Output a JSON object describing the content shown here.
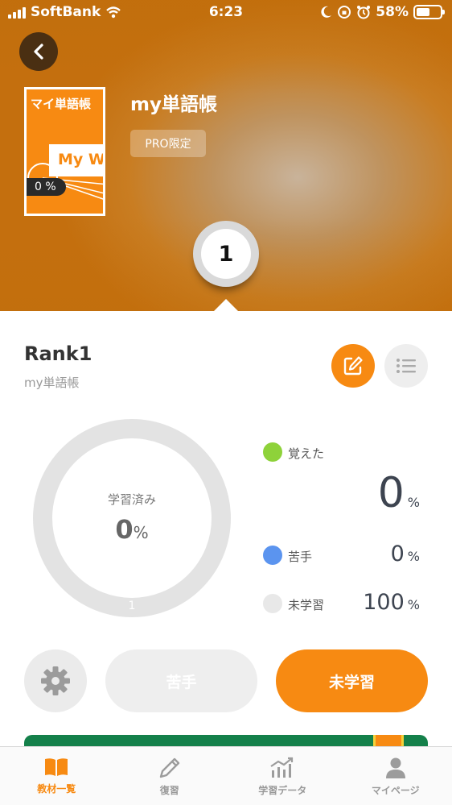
{
  "status_bar": {
    "carrier": "SoftBank",
    "time": "6:23",
    "battery": "58%"
  },
  "header": {
    "book_cover_title": "マイ単語帳",
    "book_cover_subtitle": "My W",
    "book_progress": "0 %",
    "title": "my単語帳",
    "badge": "PRO限定",
    "rank_number": "1"
  },
  "rank": {
    "title": "Rank1",
    "subtitle": "my単語帳"
  },
  "progress": {
    "center_label": "学習済み",
    "center_value": "0",
    "center_unit": "%",
    "tick_label": "1",
    "learned_fraction": 0,
    "items": [
      {
        "label": "覚えた",
        "value": "0",
        "unit": "%",
        "color": "#8ed23a"
      },
      {
        "label": "苦手",
        "value": "0",
        "unit": "%",
        "color": "#5b94ef"
      },
      {
        "label": "未学習",
        "value": "100",
        "unit": "%",
        "color": "#e8e8e8"
      }
    ]
  },
  "actions": {
    "weak_label": "苦手",
    "unlearned_label": "未学習"
  },
  "tabs": [
    {
      "label": "教材一覧",
      "icon": "book-icon",
      "active": true
    },
    {
      "label": "復習",
      "icon": "pencil-icon",
      "active": false
    },
    {
      "label": "学習データ",
      "icon": "chart-icon",
      "active": false
    },
    {
      "label": "マイページ",
      "icon": "person-icon",
      "active": false
    }
  ],
  "colors": {
    "accent": "#f78a12",
    "ring": "#e3e3e3"
  }
}
